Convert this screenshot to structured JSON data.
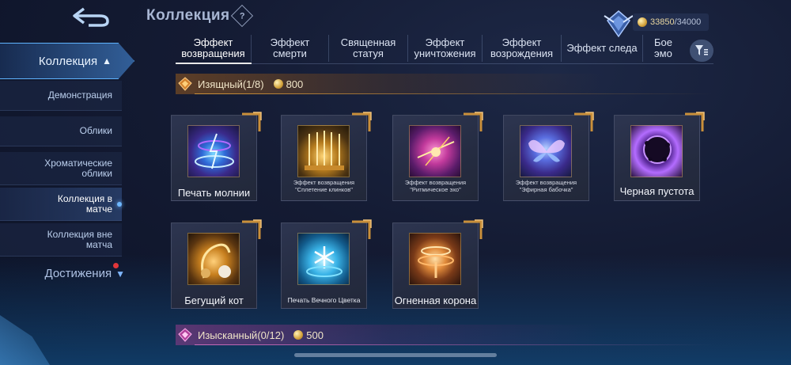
{
  "header": {
    "title": "Коллекция",
    "help_glyph": "?"
  },
  "currency": {
    "current": "33850",
    "max": "/34000",
    "icon": "gold-coin-icon"
  },
  "sidebar": {
    "main_label": "Коллекция",
    "items": [
      {
        "label": "Демонстрация"
      },
      {
        "label": "Облики"
      },
      {
        "label": "Хроматические облики"
      },
      {
        "label": "Коллекция в матче"
      },
      {
        "label": "Коллекция вне матча"
      }
    ],
    "achievements_label": "Достижения"
  },
  "tabs": [
    {
      "label": "Эффект возвращения"
    },
    {
      "label": "Эффект смерти"
    },
    {
      "label": "Священная статуя"
    },
    {
      "label": "Эффект уничтожения"
    },
    {
      "label": "Эффект возрождения"
    },
    {
      "label": "Эффект следа"
    },
    {
      "label": "Бое эмо"
    }
  ],
  "sections": [
    {
      "name": "Изящный(1/8)",
      "price": "800",
      "items": [
        {
          "label": "Печать молнии"
        },
        {
          "label": "Эффект возвращения \"Сплетение клинков\""
        },
        {
          "label": "Эффект возвращения \"Ритмическое эхо\""
        },
        {
          "label": "Эффект возвращения \"Эфирная бабочка\""
        },
        {
          "label": "Черная пустота"
        },
        {
          "label": "Бегущий кот"
        },
        {
          "label": "Печать Вечного Цветка"
        },
        {
          "label": "Огненная корона"
        }
      ]
    },
    {
      "name": "Изысканный(0/12)",
      "price": "500"
    }
  ],
  "colors": {
    "accent_blue": "#5fb4ff",
    "gold": "#c98f3a",
    "notification_red": "#e1363a"
  }
}
